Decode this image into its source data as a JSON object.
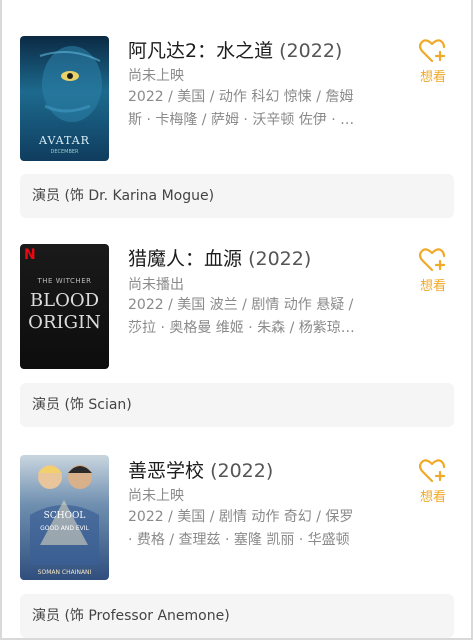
{
  "movies": [
    {
      "title": "阿凡达2：水之道",
      "year": "(2022)",
      "status": "尚未上映",
      "meta_line1": "2022 / 美国 / 动作 科幻 惊悚 / 詹姆",
      "meta_line2": "斯 · 卡梅隆 / 萨姆 · 沃辛顿 佐伊 · …",
      "wish_label": "想看",
      "role": "演员 (饰 Dr. Karina Mogue)",
      "poster_text": "AVATAR",
      "poster_sub": "DECEMBER"
    },
    {
      "title": "猎魔人：血源",
      "year": "(2022)",
      "status": "尚未播出",
      "meta_line1": "2022 / 美国 波兰 / 剧情 动作 悬疑 /",
      "meta_line2": "莎拉 · 奥格曼 维姬 · 朱森 / 杨紫琼…",
      "wish_label": "想看",
      "role": "演员 (饰 Scian)",
      "poster_text_top": "THE WITCHER",
      "poster_text_mid": "BLOOD",
      "poster_text_bot": "ORIGIN",
      "poster_badge": "N"
    },
    {
      "title": "善恶学校",
      "year": "(2022)",
      "status": "尚未上映",
      "meta_line1": "2022 / 美国 / 剧情 动作 奇幻 / 保罗",
      "meta_line2": "· 费格 / 查理兹 · 塞隆 凯丽 · 华盛顿",
      "wish_label": "想看",
      "role": "演员 (饰 Professor Anemone)",
      "poster_text_a": "SCHOOL",
      "poster_text_b": "GOOD AND EVIL",
      "poster_text_c": "SOMAN CHAINANI"
    }
  ],
  "colors": {
    "accent": "#f0a928",
    "role_bg": "#f5f5f6"
  }
}
